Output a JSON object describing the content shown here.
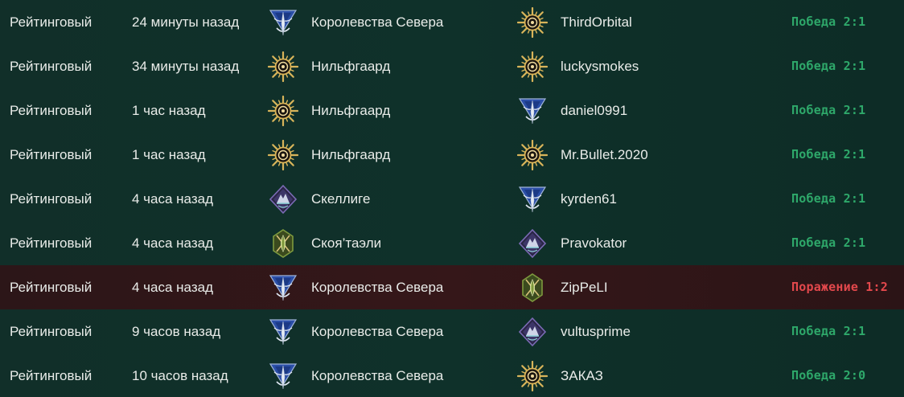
{
  "colors": {
    "win": "#2ea86a",
    "lose": "#e3484c",
    "northern_realms": "#2b4fa8",
    "nilfgaard": "#d8b45a",
    "skellige": "#7b6bb5",
    "scoiatael": "#7e9a3e"
  },
  "matches": [
    {
      "mode": "Рейтинговый",
      "time": "24 минуты назад",
      "faction_icon": "northern-realms-icon",
      "faction": "Королевства Севера",
      "opponent_icon": "nilfgaard-icon",
      "opponent": "ThirdOrbital",
      "result": "Победа 2:1",
      "outcome": "win"
    },
    {
      "mode": "Рейтинговый",
      "time": "34 минуты назад",
      "faction_icon": "nilfgaard-icon",
      "faction": "Нильфгаард",
      "opponent_icon": "nilfgaard-icon",
      "opponent": "luckysmokes",
      "result": "Победа 2:1",
      "outcome": "win"
    },
    {
      "mode": "Рейтинговый",
      "time": "1 час назад",
      "faction_icon": "nilfgaard-icon",
      "faction": "Нильфгаард",
      "opponent_icon": "northern-realms-icon",
      "opponent": "daniel0991",
      "result": "Победа 2:1",
      "outcome": "win"
    },
    {
      "mode": "Рейтинговый",
      "time": "1 час назад",
      "faction_icon": "nilfgaard-icon",
      "faction": "Нильфгаард",
      "opponent_icon": "nilfgaard-icon",
      "opponent": "Mr.Bullet.2020",
      "result": "Победа 2:1",
      "outcome": "win"
    },
    {
      "mode": "Рейтинговый",
      "time": "4 часа назад",
      "faction_icon": "skellige-icon",
      "faction": "Скеллиге",
      "opponent_icon": "northern-realms-icon",
      "opponent": "kyrden61",
      "result": "Победа 2:1",
      "outcome": "win"
    },
    {
      "mode": "Рейтинговый",
      "time": "4 часа назад",
      "faction_icon": "scoiatael-icon",
      "faction": "Скоя’таэли",
      "opponent_icon": "skellige-icon",
      "opponent": "Pravokator",
      "result": "Победа 2:1",
      "outcome": "win"
    },
    {
      "mode": "Рейтинговый",
      "time": "4 часа назад",
      "faction_icon": "northern-realms-icon",
      "faction": "Королевства Севера",
      "opponent_icon": "scoiatael-icon",
      "opponent": "ZipPeLI",
      "result": "Поражение 1:2",
      "outcome": "lose"
    },
    {
      "mode": "Рейтинговый",
      "time": "9 часов назад",
      "faction_icon": "northern-realms-icon",
      "faction": "Королевства Севера",
      "opponent_icon": "skellige-icon",
      "opponent": "vultusprime",
      "result": "Победа 2:1",
      "outcome": "win"
    },
    {
      "mode": "Рейтинговый",
      "time": "10 часов назад",
      "faction_icon": "northern-realms-icon",
      "faction": "Королевства Севера",
      "opponent_icon": "nilfgaard-icon",
      "opponent": "ЗАКАЗ",
      "result": "Победа 2:0",
      "outcome": "win"
    }
  ]
}
